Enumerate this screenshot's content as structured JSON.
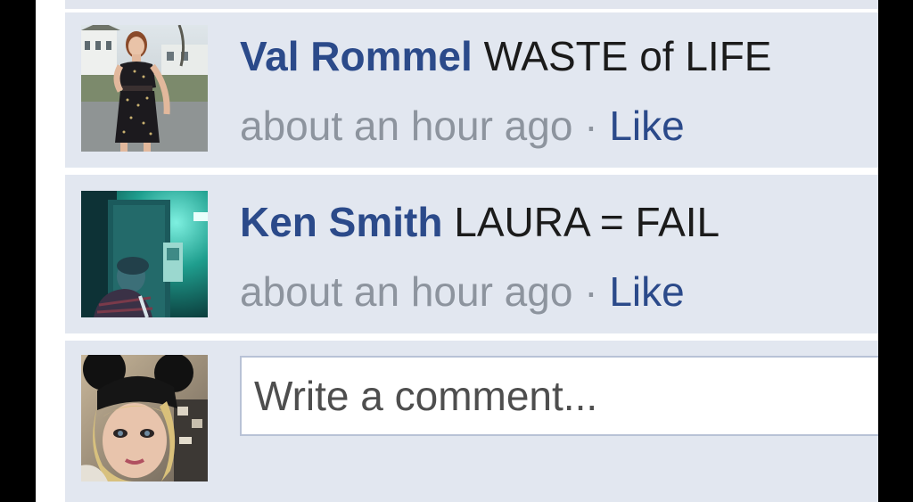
{
  "comments": [
    {
      "author": "Val Rommel",
      "text": "WASTE of LIFE",
      "time": "about an hour ago",
      "separator": "·",
      "like_label": "Like",
      "avatar_icon": "profile-photo-woman-in-black-dress"
    },
    {
      "author": "Ken Smith",
      "text": "LAURA = FAIL",
      "time": "about an hour ago",
      "separator": "·",
      "like_label": "Like",
      "avatar_icon": "profile-photo-man-teal-room"
    }
  ],
  "composer": {
    "placeholder": "Write a comment...",
    "avatar_icon": "profile-photo-blonde-girl-mouse-ears"
  },
  "colors": {
    "author_link": "#2b4a8a",
    "timestamp": "#8d949e",
    "row_background": "#e2e7f0"
  }
}
